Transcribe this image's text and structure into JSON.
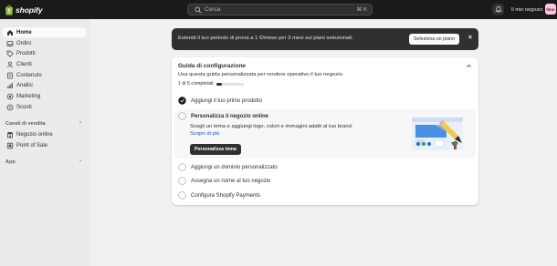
{
  "topbar": {
    "logo_text": "shopify",
    "search_placeholder": "Cerca",
    "search_shortcut": "⌘ K",
    "store_name": "Il mio negozio",
    "avatar_initials": "Ilmn"
  },
  "sidebar": {
    "items": [
      {
        "label": "Home",
        "icon": "home-icon",
        "active": true
      },
      {
        "label": "Ordini",
        "icon": "inbox-icon"
      },
      {
        "label": "Prodotti",
        "icon": "tag-icon"
      },
      {
        "label": "Clienti",
        "icon": "person-icon"
      },
      {
        "label": "Contenuto",
        "icon": "document-icon"
      },
      {
        "label": "Analisi",
        "icon": "chart-icon"
      },
      {
        "label": "Marketing",
        "icon": "target-icon"
      },
      {
        "label": "Sconti",
        "icon": "discount-icon"
      }
    ],
    "sales_channels_title": "Canali di vendita",
    "channels": [
      {
        "label": "Negozio online",
        "icon": "store-icon"
      },
      {
        "label": "Point of Sale",
        "icon": "pos-icon"
      }
    ],
    "apps_title": "App"
  },
  "banner": {
    "text": "Estendi il tuo periodo di prova a 1 €/mese per 3 mesi sui piani selezionati.",
    "button_label": "Seleziona un piano",
    "close_icon": "close-icon"
  },
  "guide": {
    "title": "Guida di configurazione",
    "subtitle": "Usa questa guida personalizzata per rendere operativo il tuo negozio.",
    "progress_label": "1 di 5 completati",
    "progress_fraction": 0.2,
    "tasks": [
      {
        "label": "Aggiungi il tuo primo prodotto",
        "done": true
      },
      {
        "label": "Personalizza il negozio online",
        "current": true
      },
      {
        "label": "Aggiungi un dominio personalizzato"
      },
      {
        "label": "Assegna un nome al tuo negozio"
      },
      {
        "label": "Configura Shopify Payments"
      }
    ],
    "current_description": "Scegli un tema e aggiungi logo, colori e immagini adatti al tuo brand.",
    "current_link": "Scopri di più",
    "current_button": "Personalizza tema"
  },
  "colors": {
    "topbar": "#1a1a1a",
    "sidebar": "#ebebeb",
    "banner": "#303030",
    "link": "#005bd3",
    "illustration_blue": "#4a90e2"
  }
}
